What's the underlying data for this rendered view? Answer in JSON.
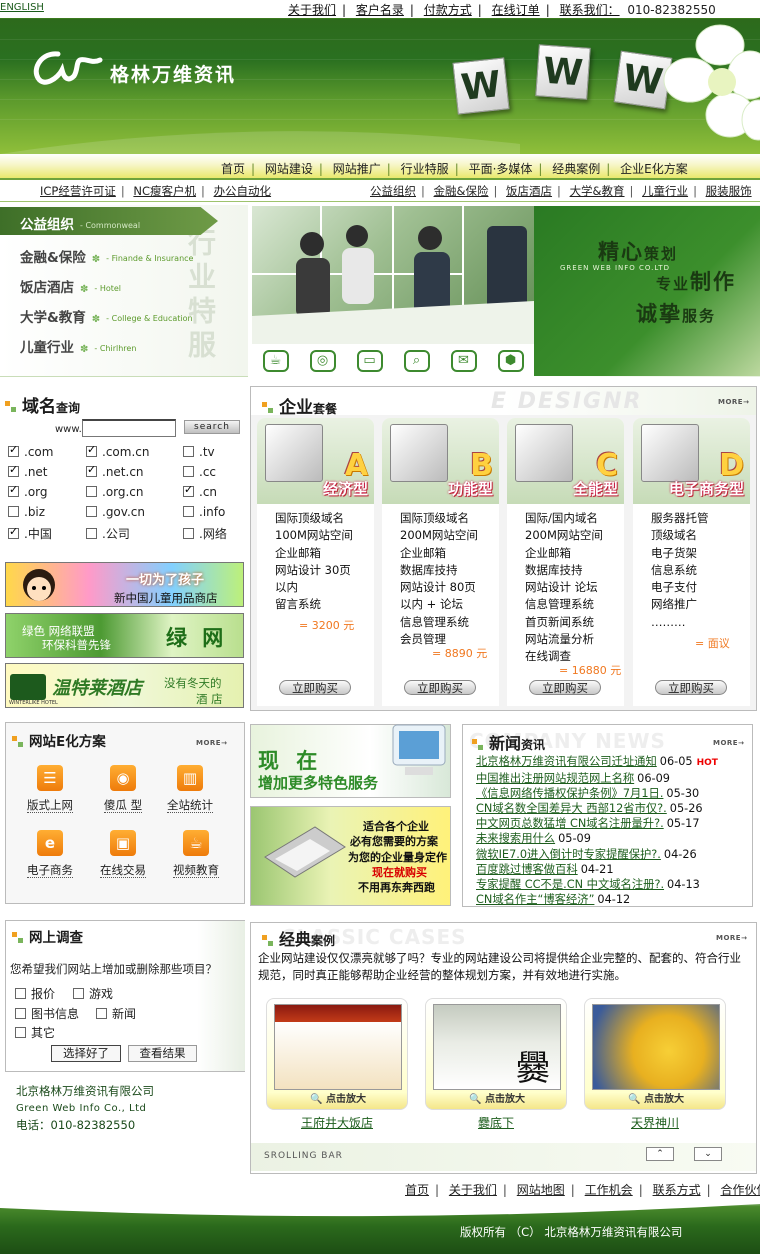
{
  "top": {
    "english": "ENGLISH",
    "links": [
      "关于我们",
      "客户名录",
      "付款方式",
      "在线订单",
      "联系我们："
    ],
    "phone": "010-82382550"
  },
  "header": {
    "logo_text": "格林万维资讯",
    "tiles": [
      "W",
      "W",
      "W"
    ]
  },
  "nav": {
    "items": [
      "首页",
      "网站建设",
      "网站推广",
      "行业特服",
      "平面·多媒体",
      "经典案例",
      "企业E化方案"
    ]
  },
  "subnav": {
    "left": [
      "ICP经营许可证",
      "NC瘦客户机",
      "办公自动化"
    ],
    "right": [
      "公益组织",
      "金融&保险",
      "饭店酒店",
      "大学&教育",
      "儿童行业",
      "服装服饰"
    ]
  },
  "categories": [
    {
      "cn": "公益组织",
      "en": "Commonweal"
    },
    {
      "cn": "金融&保险",
      "en": "Finande & Insurance"
    },
    {
      "cn": "饭店酒店",
      "en": "Hotel"
    },
    {
      "cn": "大学&教育",
      "en": "College & Education"
    },
    {
      "cn": "儿童行业",
      "en": "Chirlhren"
    }
  ],
  "category_watermark": "行业特服",
  "banner": {
    "line1a": "精心",
    "line1b": "策划",
    "en": "GREEN WEB INFO CO.LTD",
    "line2a": "专业",
    "line2b": "制作",
    "line3a": "诚挚",
    "line3b": "服务",
    "icons": [
      "☕",
      "◎",
      "▭",
      "⌕",
      "✉",
      "⬢"
    ]
  },
  "domain": {
    "title": "域名",
    "title_small": "查询",
    "prefix": "www.",
    "search_label": "search",
    "options": [
      {
        "label": ".com",
        "checked": true
      },
      {
        "label": ".com.cn",
        "checked": true
      },
      {
        "label": ".tv",
        "checked": false
      },
      {
        "label": ".net",
        "checked": true
      },
      {
        "label": ".net.cn",
        "checked": true
      },
      {
        "label": ".cc",
        "checked": false
      },
      {
        "label": ".org",
        "checked": true
      },
      {
        "label": ".org.cn",
        "checked": false
      },
      {
        "label": ".cn",
        "checked": true
      },
      {
        "label": ".biz",
        "checked": false
      },
      {
        "label": ".gov.cn",
        "checked": false
      },
      {
        "label": ".info",
        "checked": false
      },
      {
        "label": ".中国",
        "checked": true
      },
      {
        "label": ".公司",
        "checked": false
      },
      {
        "label": ".网络",
        "checked": false
      }
    ]
  },
  "promos": {
    "p1a": "一切为了孩子",
    "p1b": "新中国儿童用品商店",
    "p2a": "绿色 网络联盟",
    "p2b": "环保科普先锋",
    "p2c": "绿 网",
    "p3a": "温特莱酒店",
    "p3b": "没有冬天的",
    "p3c": "酒  店",
    "p3logo": "WINTERLIKE HOTEL"
  },
  "packages": {
    "title": "企业",
    "title_small": "套餐",
    "more": "MORE→",
    "cards": [
      {
        "letter": "A",
        "type": "经济型",
        "items": [
          "国际顶级域名",
          "100M网站空间",
          "企业邮箱",
          "网站设计  30页",
          "以内",
          "留言系统"
        ],
        "price": "=  3200  元",
        "buy": "立即购买"
      },
      {
        "letter": "B",
        "type": "功能型",
        "items": [
          "国际顶级域名",
          "200M网站空间",
          "企业邮箱",
          "数据库技持",
          "网站设计  80页",
          "以内  +  论坛",
          "信息管理系统",
          "会员管理"
        ],
        "price": "=  8890  元",
        "buy": "立即购买"
      },
      {
        "letter": "C",
        "type": "全能型",
        "items": [
          "国际/国内域名",
          "200M网站空间",
          "企业邮箱",
          "数据库技持",
          "网站设计   论坛",
          "信息管理系统",
          "首页新闻系统",
          "网站流量分析",
          "在线调查"
        ],
        "price": "=  16880  元",
        "buy": "立即购买"
      },
      {
        "letter": "D",
        "type": "电子商务型",
        "items": [
          "服务器托管",
          "顶级域名",
          "电子货架",
          "信息系统",
          "电子支付",
          "网络推广",
          "………"
        ],
        "price": "=  面议",
        "buy": "立即购买"
      }
    ]
  },
  "esolutions": {
    "title": "网站E化方案",
    "more": "MORE→",
    "items": [
      {
        "label": "版式上网",
        "glyph": "☰"
      },
      {
        "label": "傻瓜  型",
        "glyph": "◉"
      },
      {
        "label": "全站统计",
        "glyph": "▥"
      },
      {
        "label": "电子商务",
        "glyph": "e"
      },
      {
        "label": "在线交易",
        "glyph": "▣"
      },
      {
        "label": "视频教育",
        "glyph": "☕"
      }
    ]
  },
  "mid": {
    "t1": "现 在",
    "t2": "增加更多特色服务",
    "lines": [
      "适合各个企业",
      "必有您需要的方案",
      "为您的企业量身定作",
      "现在就购买",
      "不用再东奔西跑"
    ]
  },
  "news": {
    "title": "新闻",
    "title_small": "资讯",
    "more": "MORE→",
    "watermark": "COMPANY NEWS",
    "items": [
      {
        "text": "北京格林万维资讯有限公司迁址通知",
        "date": "06-05",
        "hot": "HOT"
      },
      {
        "text": "中国推出注册网站规范网上名称",
        "date": "06-09"
      },
      {
        "text": "《信息网络传播权保护条例》7月1日.",
        "date": "05-30"
      },
      {
        "text": "CN域名数全国差异大 西部12省市仅?.",
        "date": "05-26"
      },
      {
        "text": "中文网页总数猛增 CN域名注册量升?.",
        "date": "05-17"
      },
      {
        "text": "未来搜索用什么",
        "date": "05-09"
      },
      {
        "text": "微软IE7.0进入倒计时专家提醒保护?.",
        "date": "04-26"
      },
      {
        "text": "百度跳过博客做百科",
        "date": "04-21"
      },
      {
        "text": "专家提醒 CC不是.CN 中文域名注册?.",
        "date": "04-13"
      },
      {
        "text": "CN域名作主“博客经济”",
        "date": "04-12"
      }
    ]
  },
  "survey": {
    "title": "网上调查",
    "question": "您希望我们网站上增加或删除那些项目？",
    "options": [
      "报价",
      "游戏",
      "图书信息",
      "新闻",
      "其它"
    ],
    "submit": "选择好了",
    "results": "查看结果"
  },
  "company": {
    "name": "北京格林万维资讯有限公司",
    "en": "Green Web Info Co., Ltd",
    "phone": "电话：010-82382550"
  },
  "cases": {
    "title": "经典",
    "title_small": "案例",
    "more": "MORE→",
    "watermark": "CLASSIC CASES",
    "desc": "企业网站建设仅仅漂亮就够了吗？专业的网站建设公司将提供给企业完整的、配套的、符合行业规范，同时真正能够帮助企业经营的整体规划方案，并有效地进行实施。",
    "items": [
      {
        "name": "王府井大饭店",
        "zoom": "点击放大"
      },
      {
        "name": "爨底下",
        "zoom": "点击放大",
        "glyph": "爨"
      },
      {
        "name": "天界神川",
        "zoom": "点击放大"
      }
    ],
    "scroll_label": "SROLLING BAR",
    "up": "⌃",
    "down": "⌄"
  },
  "footer": {
    "links": [
      "首页",
      "关于我们",
      "网站地图",
      "工作机会",
      "联系方式",
      "合作伙伴"
    ],
    "copyright": "版权所有 （C） 北京格林万维资讯有限公司"
  }
}
